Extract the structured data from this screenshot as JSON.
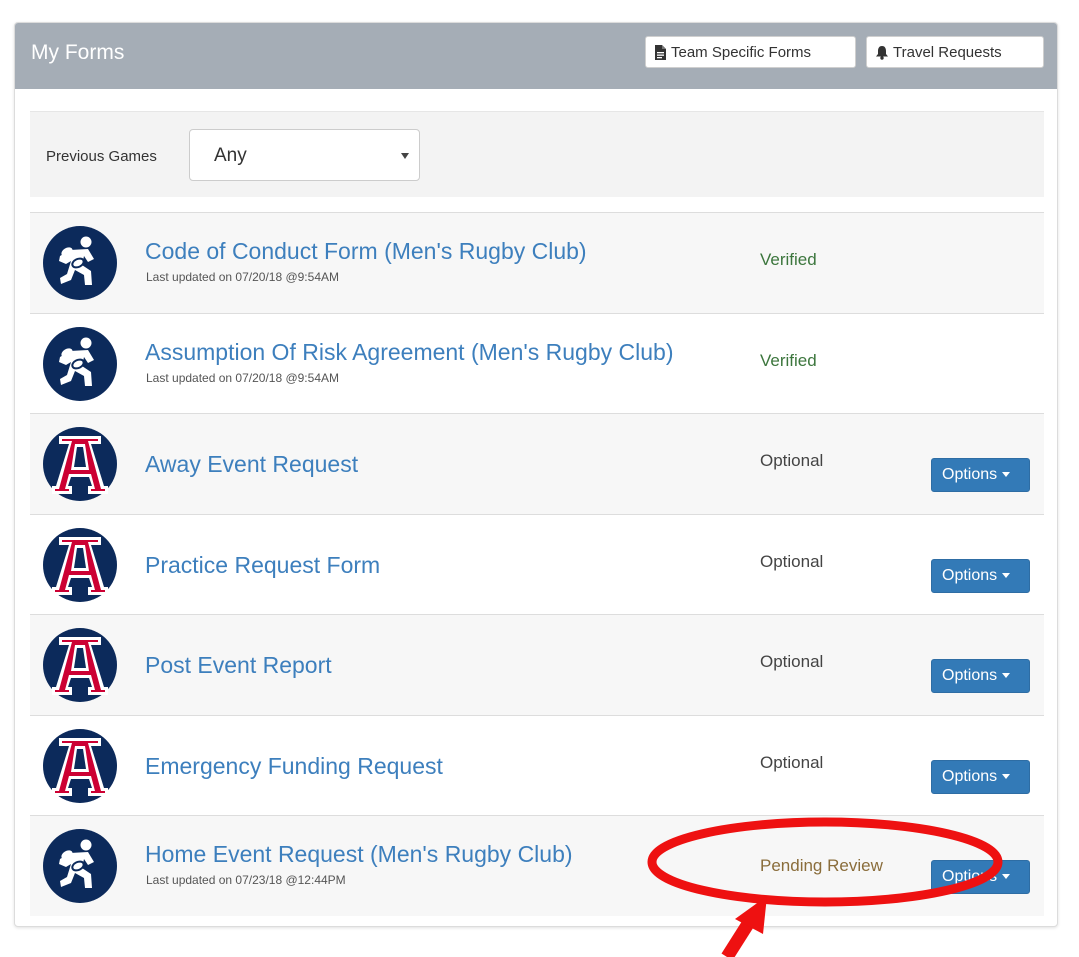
{
  "header": {
    "title": "My Forms",
    "team_forms_label": "Team Specific Forms",
    "travel_requests_label": "Travel Requests"
  },
  "filter": {
    "label": "Previous Games",
    "selected": "Any"
  },
  "forms": [
    {
      "title": "Code of Conduct Form",
      "team": "(Men's Rugby Club)",
      "updated": "Last updated on 07/20/18 @9:54AM",
      "status": "Verified",
      "logo": "rugby-club-logo",
      "options": ""
    },
    {
      "title": "Assumption Of Risk Agreement",
      "team": "(Men's Rugby Club)",
      "updated": "Last updated on 07/20/18 @9:54AM",
      "status": "Verified",
      "logo": "rugby-club-logo",
      "options": ""
    },
    {
      "title": "Away Event Request",
      "team": "",
      "updated": "",
      "status": "Optional",
      "logo": "university-a-logo",
      "options": "Options"
    },
    {
      "title": "Practice Request Form",
      "team": "",
      "updated": "",
      "status": "Optional",
      "logo": "university-a-logo",
      "options": "Options"
    },
    {
      "title": "Post Event Report",
      "team": "",
      "updated": "",
      "status": "Optional",
      "logo": "university-a-logo",
      "options": "Options"
    },
    {
      "title": "Emergency Funding Request",
      "team": "",
      "updated": "",
      "status": "Optional",
      "logo": "university-a-logo",
      "options": "Options"
    },
    {
      "title": "Home Event Request",
      "team": "(Men's Rugby Club)",
      "updated": "Last updated on 07/23/18 @12:44PM",
      "status": "Pending Review",
      "logo": "rugby-club-logo",
      "options": "Options"
    }
  ],
  "colors": {
    "header_bg": "#a5adb6",
    "link": "#3d7fbd",
    "verified": "#3c763d",
    "pending": "#8a6d3b",
    "primary_button": "#337ab7",
    "annotation": "#ee1111"
  }
}
